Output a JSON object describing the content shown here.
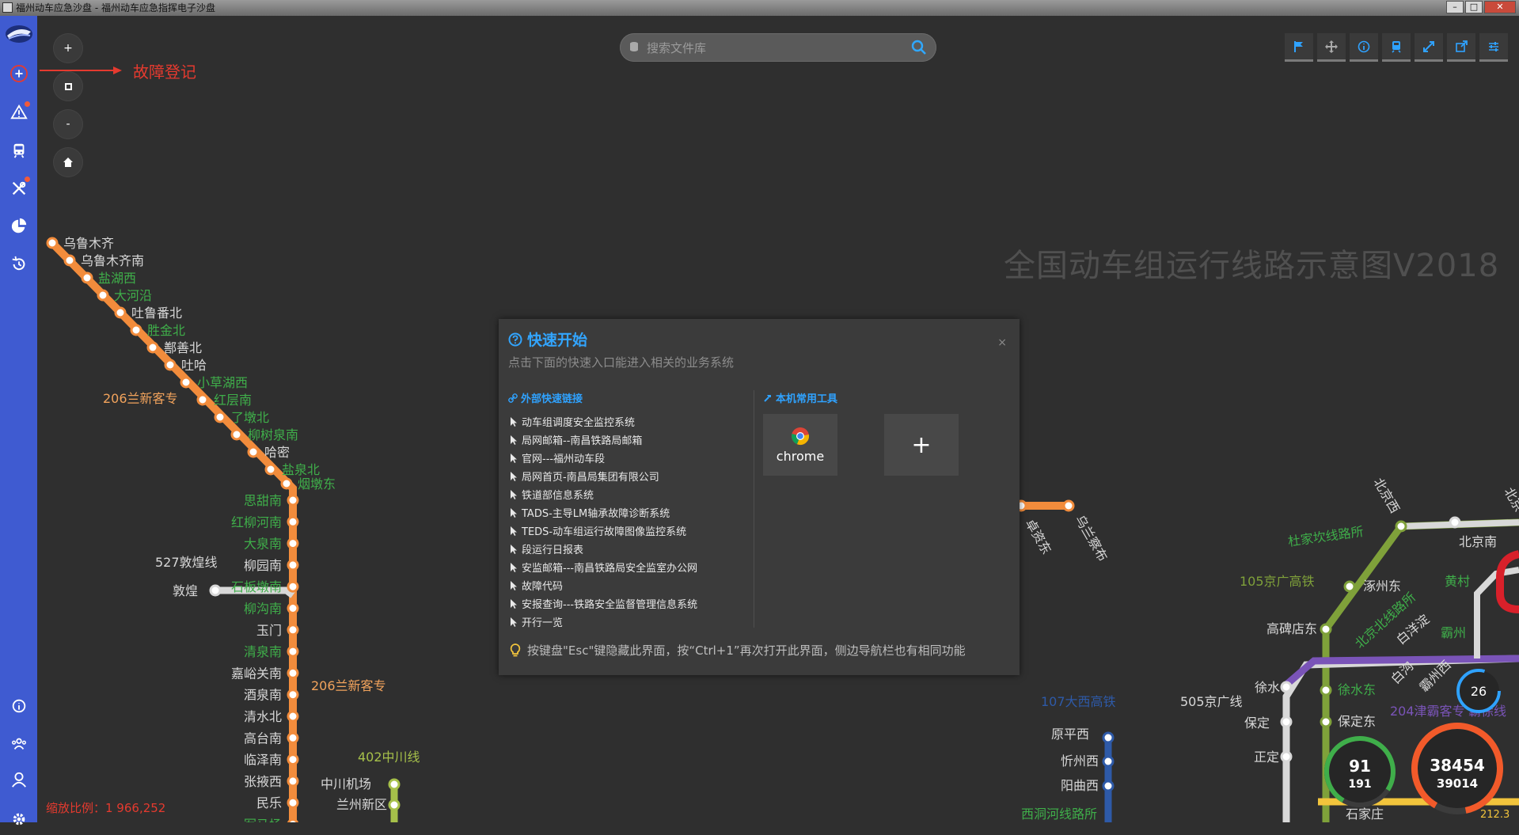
{
  "window": {
    "title": "福州动车应急沙盘 - 福州动车应急指挥电子沙盘"
  },
  "annotation": {
    "label": "故障登记"
  },
  "search": {
    "placeholder": "搜索文件库"
  },
  "map": {
    "title": "全国动车组运行线路示意图V2018",
    "scale_label": "缩放比例：1 966,252",
    "stations": [
      {
        "name": "乌鲁木齐",
        "color": "#d8d8d8"
      },
      {
        "name": "乌鲁木齐南",
        "color": "#d8d8d8"
      },
      {
        "name": "盐湖西",
        "color": "#3fae4a"
      },
      {
        "name": "大河沿",
        "color": "#3fae4a"
      },
      {
        "name": "吐鲁番北",
        "color": "#d8d8d8"
      },
      {
        "name": "胜金北",
        "color": "#3fae4a"
      },
      {
        "name": "鄯善北",
        "color": "#d8d8d8"
      },
      {
        "name": "吐哈",
        "color": "#d8d8d8"
      },
      {
        "name": "小草湖西",
        "color": "#3fae4a"
      },
      {
        "name": "红层南",
        "color": "#3fae4a"
      },
      {
        "name": "了墩北",
        "color": "#3fae4a"
      },
      {
        "name": "柳树泉南",
        "color": "#3fae4a"
      },
      {
        "name": "哈密",
        "color": "#d8d8d8"
      },
      {
        "name": "盐泉北",
        "color": "#3fae4a"
      },
      {
        "name": "烟墩东",
        "color": "#3fae4a"
      },
      {
        "name": "思甜南",
        "color": "#3fae4a"
      },
      {
        "name": "红柳河南",
        "color": "#3fae4a"
      },
      {
        "name": "大泉南",
        "color": "#3fae4a"
      },
      {
        "name": "柳园南",
        "color": "#d8d8d8"
      },
      {
        "name": "石板墩南",
        "color": "#3fae4a"
      },
      {
        "name": "柳沟南",
        "color": "#3fae4a"
      },
      {
        "name": "玉门",
        "color": "#d8d8d8"
      },
      {
        "name": "清泉南",
        "color": "#3fae4a"
      },
      {
        "name": "嘉峪关南",
        "color": "#d8d8d8"
      },
      {
        "name": "酒泉南",
        "color": "#d8d8d8"
      },
      {
        "name": "清水北",
        "color": "#d8d8d8"
      },
      {
        "name": "高台南",
        "color": "#d8d8d8"
      },
      {
        "name": "临泽南",
        "color": "#d8d8d8"
      },
      {
        "name": "张掖西",
        "color": "#d8d8d8"
      },
      {
        "name": "民乐",
        "color": "#d8d8d8"
      },
      {
        "name": "军马场",
        "color": "#3fae4a"
      }
    ],
    "line_labels": {
      "l206a": "206兰新客专",
      "l206b": "206兰新客专",
      "l527": "527敦煌线",
      "l402": "402中川线",
      "l105": "105京广高铁",
      "l505": "505京广线",
      "l107": "107大西高铁",
      "l204": "204津霸客专",
      "l204b": "霸徐线"
    },
    "other_stations": {
      "dunhuang": "敦煌",
      "zhongchuan": "中川机场",
      "lanzhou_xinqu": "兰州新区",
      "wulan": "乌兰察布",
      "zhuozi": "卓资东",
      "beijingxi": "北京西",
      "beijingnan": "北京南",
      "beijing": "北京",
      "zhuoshou": "涿州东",
      "huangcun": "黄村",
      "gaobeidian": "高碑店东",
      "baiyangdian": "白洋淀",
      "bazhou": "霸州",
      "bazhouxi": "霸州西",
      "baigou": "白沟",
      "xushui_e": "徐水东",
      "xushui": "徐水",
      "baoding": "保定",
      "baodingdong": "保定东",
      "zhengding": "正定",
      "yuanpingxi": "原平西",
      "xinzhouxi": "忻州西",
      "yangquxi": "阳曲西",
      "shijiazhuang": "石家庄",
      "duzhuang": "杜家坎线路所",
      "xiheng": "西洞河线路所",
      "beijing_hq": "北京北线路所"
    },
    "gauges": {
      "g1_top": "91",
      "g1_bottom": "191",
      "g2_top": "38454",
      "g2_bottom": "39014",
      "g3": "26",
      "km": "212.3"
    }
  },
  "quickstart": {
    "title": "快速开始",
    "subtitle": "点击下面的快速入口能进入相关的业务系统",
    "external_title": "外部快速链接",
    "local_title": "本机常用工具",
    "links": [
      "动车组调度安全监控系统",
      "局网邮箱--南昌铁路局邮箱",
      "官网---福州动车段",
      "局网首页-南昌局集团有限公司",
      "铁道部信息系统",
      "TADS-主导LM轴承故障诊断系统",
      "TEDS-动车组运行故障图像监控系统",
      "段运行日报表",
      "安监邮箱---南昌铁路局安全监室办公网",
      "故障代码",
      "安报查询---铁路安全监督管理信息系统",
      "开行一览"
    ],
    "tools": [
      {
        "label": "chrome"
      }
    ],
    "add_label": "+",
    "close_label": "×",
    "tip": "按键盘\"Esc\"键隐藏此界面，按“Ctrl+1”再次打开此界面，侧边导航栏也有相同功能"
  },
  "colors": {
    "sidebar": "#3f5bd1",
    "accent": "#2fa2ff",
    "line_orange": "#f28c3c",
    "line_green": "#3fae4a",
    "line_purple": "#7a54b8",
    "line_red": "#d8202a"
  }
}
